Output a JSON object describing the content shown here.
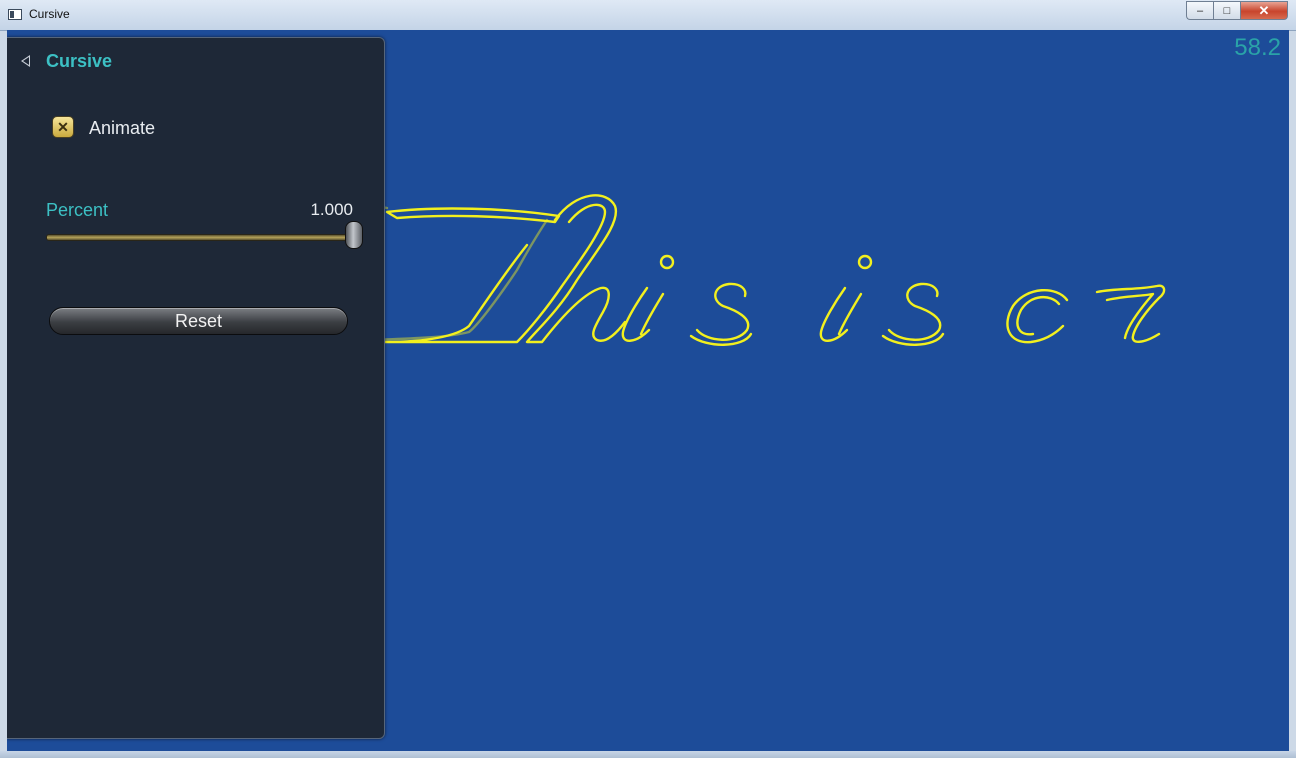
{
  "window": {
    "title": "Cursive",
    "controls": {
      "minimize": "–",
      "maximize": "□",
      "close": "✕"
    }
  },
  "panel": {
    "title": "Cursive",
    "animate": {
      "label": "Animate",
      "checked": true
    },
    "percent": {
      "label": "Percent",
      "value": "1.000",
      "fraction": 1.0
    },
    "reset_label": "Reset"
  },
  "fps": "58.2",
  "canvas": {
    "text": "This is cr",
    "background": "#1d4c99",
    "stroke_color": "#f2f01e"
  },
  "colors": {
    "accent": "#3cc0c4",
    "panel": "#1e2837"
  }
}
